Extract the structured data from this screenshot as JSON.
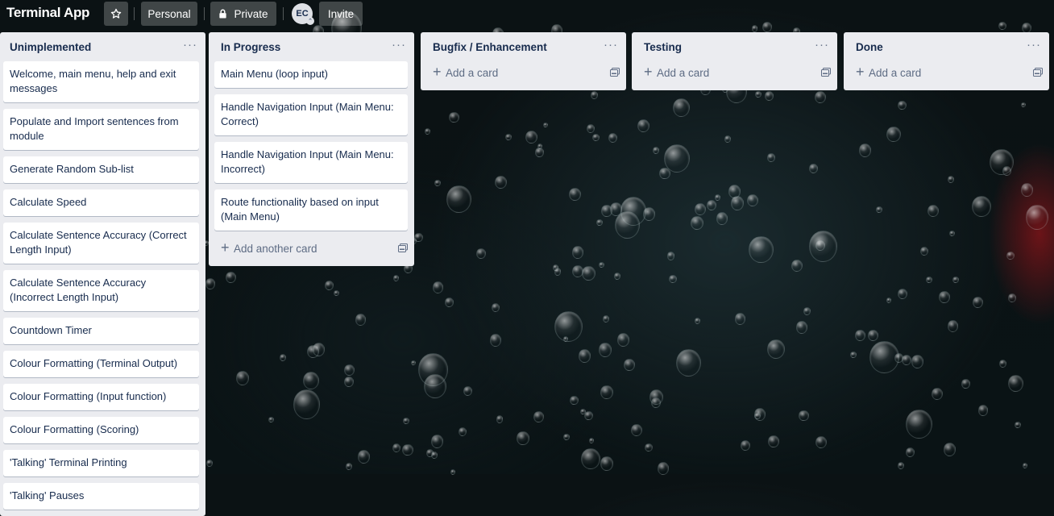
{
  "header": {
    "board_title": "Terminal App",
    "star_icon": "star-icon",
    "workspace_label": "Personal",
    "visibility_icon": "lock-icon",
    "visibility_label": "Private",
    "avatar_initials": "EC",
    "invite_label": "Invite"
  },
  "lists": [
    {
      "title": "Unimplemented",
      "menu_icon": "more-horizontal-icon",
      "cards": [
        "Welcome, main menu, help and exit messages",
        "Populate and Import sentences from module",
        "Generate Random Sub-list",
        "Calculate Speed",
        "Calculate Sentence Accuracy (Correct Length Input)",
        "Calculate Sentence Accuracy (Incorrect Length Input)",
        "Countdown Timer",
        "Colour Formatting (Terminal Output)",
        "Colour Formatting (Input function)",
        "Colour Formatting (Scoring)",
        "'Talking' Terminal Printing",
        "'Talking' Pauses"
      ]
    },
    {
      "title": "In Progress",
      "menu_icon": "more-horizontal-icon",
      "cards": [
        "Main Menu (loop input)",
        "Handle Navigation Input (Main Menu: Correct)",
        "Handle Navigation Input (Main Menu: Incorrect)",
        "Route functionality based on input (Main Menu)"
      ],
      "add_label": "Add another card"
    },
    {
      "title": "Bugfix / Enhancement",
      "menu_icon": "more-horizontal-icon",
      "cards": [],
      "add_label": "Add a card"
    },
    {
      "title": "Testing",
      "menu_icon": "more-horizontal-icon",
      "cards": [],
      "add_label": "Add a card"
    },
    {
      "title": "Done",
      "menu_icon": "more-horizontal-icon",
      "cards": [],
      "add_label": "Add a card"
    }
  ]
}
